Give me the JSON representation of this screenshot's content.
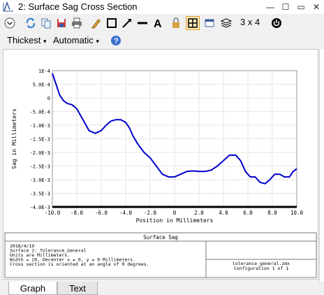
{
  "window": {
    "title": "2: Surface Sag Cross Section"
  },
  "toolbar": {
    "grid_label": "3 x 4",
    "line_width": "Thickest",
    "scale": "Automatic"
  },
  "chart_data": {
    "type": "line",
    "title": "",
    "xlabel": "Position in Millimeters",
    "ylabel": "Sag in Millimeters",
    "xlim": [
      -10,
      10
    ],
    "ylim": [
      -0.004,
      0.001
    ],
    "x_ticks": [
      "-10.0",
      "-8.0",
      "-6.0",
      "-4.0",
      "-2.0",
      "0",
      "2.0",
      "4.0",
      "6.0",
      "8.0",
      "10.0"
    ],
    "y_ticks": [
      "1E-4",
      "5.0E-4",
      "0",
      "-5.0E-4",
      "-1.0E-3",
      "-1.5E-3",
      "-2.0E-3",
      "-2.5E-3",
      "-3.0E-3",
      "-3.5E-3",
      "-4.0E-3"
    ],
    "series": [
      {
        "color": "#0000cc",
        "x": [
          -10.0,
          -9.7,
          -9.4,
          -9.1,
          -8.8,
          -8.4,
          -8.0,
          -7.5,
          -7.0,
          -6.5,
          -6.0,
          -5.6,
          -5.2,
          -4.8,
          -4.4,
          -4.0,
          -3.7,
          -3.4,
          -3.0,
          -2.5,
          -2.0,
          -1.5,
          -1.0,
          -0.5,
          0.0,
          0.5,
          1.0,
          1.5,
          2.0,
          2.5,
          3.0,
          3.5,
          4.0,
          4.5,
          5.0,
          5.4,
          5.8,
          6.2,
          6.6,
          7.0,
          7.4,
          7.8,
          8.2,
          8.6,
          9.0,
          9.4,
          9.7,
          10.0
        ],
        "y": [
          0.0009,
          0.0005,
          0.0001,
          -0.0001,
          -0.0002,
          -0.00025,
          -0.0004,
          -0.0008,
          -0.0012,
          -0.0013,
          -0.0012,
          -0.001,
          -0.00085,
          -0.0008,
          -0.0008,
          -0.0009,
          -0.0011,
          -0.0014,
          -0.0017,
          -0.002,
          -0.0022,
          -0.0025,
          -0.0028,
          -0.0029,
          -0.0029,
          -0.0028,
          -0.0027,
          -0.00268,
          -0.0027,
          -0.0027,
          -0.00265,
          -0.0025,
          -0.0023,
          -0.0021,
          -0.0021,
          -0.0023,
          -0.0027,
          -0.0029,
          -0.0029,
          -0.0031,
          -0.00315,
          -0.003,
          -0.0028,
          -0.0028,
          -0.0029,
          -0.0029,
          -0.0027,
          -0.0026
        ]
      }
    ]
  },
  "info": {
    "header": "Surface Sag",
    "lines": [
      "2018/4/19",
      "Surface 2: Tolerance_General",
      "Units are Millimeters.",
      "Width = 20, Decenter x = 0, y = 0 Millimeters.",
      "Cross section is oriented at an angle of 0 degrees."
    ],
    "file": "tolerance_general.zmx",
    "config": "Configuration 1 of 1"
  },
  "tabs": [
    "Graph",
    "Text"
  ]
}
